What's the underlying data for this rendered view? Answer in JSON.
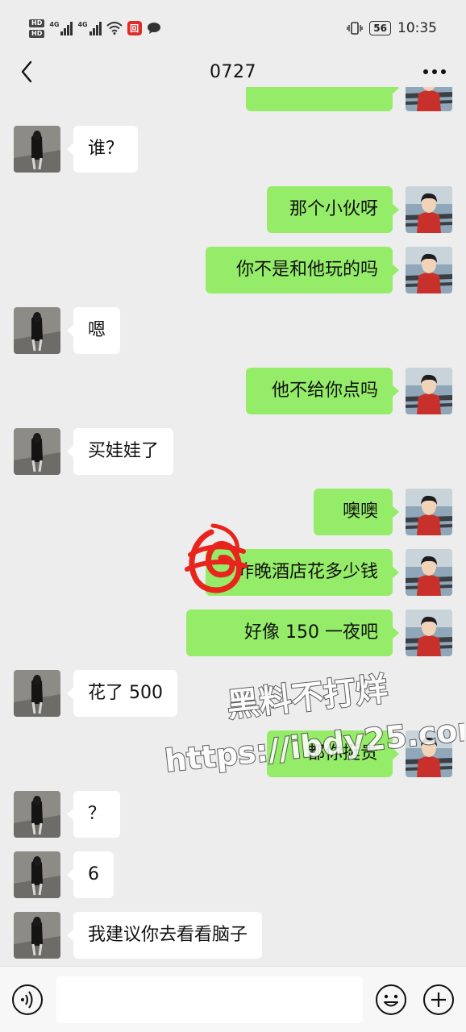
{
  "status_bar": {
    "hd1": "HD",
    "hd2": "HD",
    "net1": "4G",
    "net2": "4G",
    "battery": "56",
    "time": "10:35",
    "notif_glyph": "回"
  },
  "chat": {
    "title": "0727",
    "messages": [
      {
        "side": "right",
        "text": ""
      },
      {
        "side": "left",
        "text": "谁？"
      },
      {
        "side": "right",
        "text": "那个小伙呀"
      },
      {
        "side": "right",
        "text": "你不是和他玩的吗"
      },
      {
        "side": "left",
        "text": "嗯"
      },
      {
        "side": "right",
        "text": "他不给你点吗"
      },
      {
        "side": "left",
        "text": "买娃娃了"
      },
      {
        "side": "right",
        "text": "噢噢"
      },
      {
        "side": "right",
        "text": "昨晚酒店花多少钱"
      },
      {
        "side": "right",
        "text": "好像 150 一夜吧"
      },
      {
        "side": "left",
        "text": "花了 500"
      },
      {
        "side": "right",
        "text": "都你挺贵"
      },
      {
        "side": "left",
        "text": "？"
      },
      {
        "side": "left",
        "text": "6"
      },
      {
        "side": "left",
        "text": "我建议你去看看脑子"
      }
    ]
  },
  "watermark": {
    "line1": "黑料不打烊",
    "line2": "https://ibdy25.com"
  },
  "input_bar": {
    "placeholder": ""
  },
  "icons": {
    "back": "back-arrow-icon",
    "more": "more-dots-icon",
    "voice": "voice-icon",
    "emoji": "emoji-icon",
    "plus": "plus-icon"
  },
  "colors": {
    "sent_bubble": "#95ec69",
    "received_bubble": "#ffffff",
    "background": "#ededed",
    "scribble": "#e8241c"
  }
}
